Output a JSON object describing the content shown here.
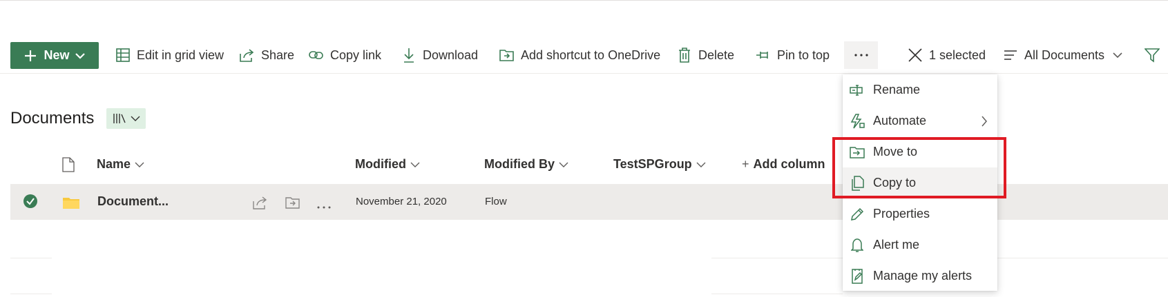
{
  "commandbar": {
    "new_label": "New",
    "edit_grid_label": "Edit in grid view",
    "share_label": "Share",
    "copy_link_label": "Copy link",
    "download_label": "Download",
    "add_shortcut_label": "Add shortcut to OneDrive",
    "delete_label": "Delete",
    "pin_label": "Pin to top",
    "selected_label": "1 selected",
    "view_label": "All Documents"
  },
  "page": {
    "title": "Documents"
  },
  "columns": {
    "name": "Name",
    "modified": "Modified",
    "modified_by": "Modified By",
    "group": "TestSPGroup",
    "add_column": "Add column"
  },
  "rows": [
    {
      "name": "Document...",
      "modified": "November 21, 2020",
      "modified_by": "Flow"
    }
  ],
  "context_menu": {
    "items": [
      {
        "label": "Rename",
        "icon": "rename-icon"
      },
      {
        "label": "Automate",
        "icon": "automate-icon"
      },
      {
        "label": "Move to",
        "icon": "move-icon"
      },
      {
        "label": "Copy to",
        "icon": "copy-icon"
      },
      {
        "label": "Properties",
        "icon": "pencil-icon"
      },
      {
        "label": "Alert me",
        "icon": "bell-icon"
      },
      {
        "label": "Manage my alerts",
        "icon": "manage-alerts-icon"
      }
    ]
  },
  "colors": {
    "accent": "#3a7c55",
    "highlight": "#e01b24",
    "selected_row": "#edebe9"
  }
}
